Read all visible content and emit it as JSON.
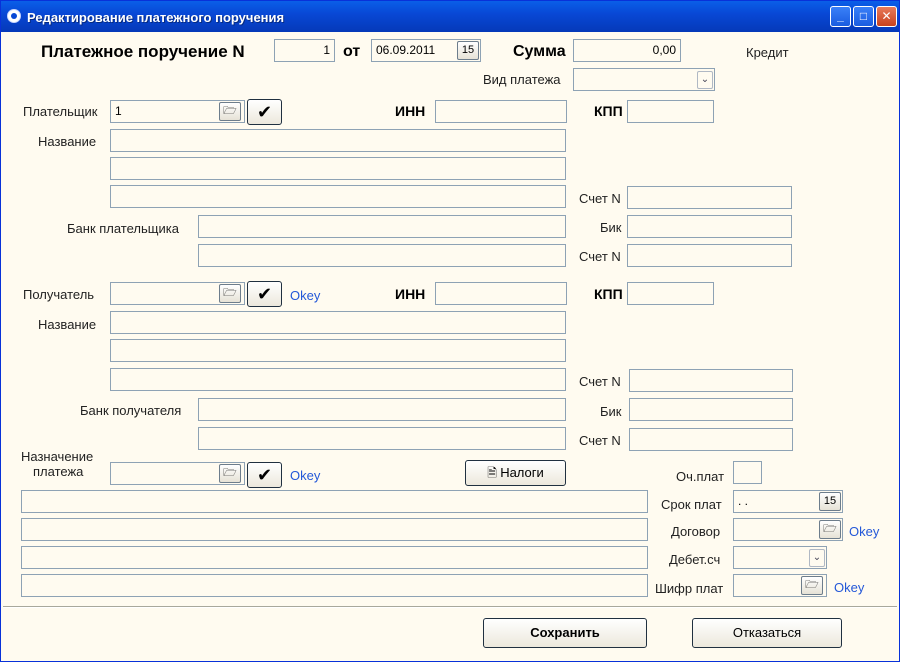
{
  "window": {
    "title": "Редактирование платежного поручения",
    "minimize_label": "_",
    "maximize_label": "□",
    "close_label": "✕"
  },
  "header": {
    "doc_label": "Платежное поручение N",
    "doc_number": "1",
    "from_label": "от",
    "date": "06.09.2011",
    "sum_label": "Сумма",
    "sum_value": "0,00",
    "credit_label": "Кредит",
    "payment_type_label": "Вид платежа",
    "payment_type_value": ""
  },
  "payer": {
    "label": "Плательщик",
    "code": "1",
    "inn_label": "ИНН",
    "inn": "",
    "kpp_label": "КПП",
    "kpp": "",
    "name_label": "Название",
    "name_lines": [
      "",
      "",
      ""
    ],
    "account_label": "Счет N",
    "account": "",
    "bank_label": "Банк плательщика",
    "bank_lines": [
      "",
      ""
    ],
    "bik_label": "Бик",
    "bik": "",
    "corr_account_label": "Счет N",
    "corr_account": ""
  },
  "payee": {
    "label": "Получатель",
    "code": "",
    "status": "Okey",
    "inn_label": "ИНН",
    "inn": "",
    "kpp_label": "КПП",
    "kpp": "",
    "name_label": "Название",
    "name_lines": [
      "",
      "",
      ""
    ],
    "account_label": "Счет N",
    "account": "",
    "bank_label": "Банк получателя",
    "bank_lines": [
      "",
      ""
    ],
    "bik_label": "Бик",
    "bik": "",
    "corr_account_label": "Счет N",
    "corr_account": ""
  },
  "purpose": {
    "label_line1": "Назначение",
    "label_line2": "платежа",
    "code": "",
    "status": "Okey",
    "taxes_button": "Налоги",
    "text_lines": [
      "",
      "",
      "",
      ""
    ]
  },
  "side": {
    "priority_label": "Оч.плат",
    "priority": "",
    "due_label": "Срок плат",
    "due_value": ". .",
    "contract_label": "Договор",
    "contract": "",
    "contract_status": "Okey",
    "debit_label": "Дебет.сч",
    "debit": "",
    "cipher_label": "Шифр плат",
    "cipher": "",
    "cipher_status": "Okey"
  },
  "footer": {
    "save_button": "Сохранить",
    "cancel_button": "Отказаться"
  },
  "icons": {
    "check": "✔",
    "folder": "🗁",
    "calendar": "15",
    "dropdown": "⌄"
  }
}
